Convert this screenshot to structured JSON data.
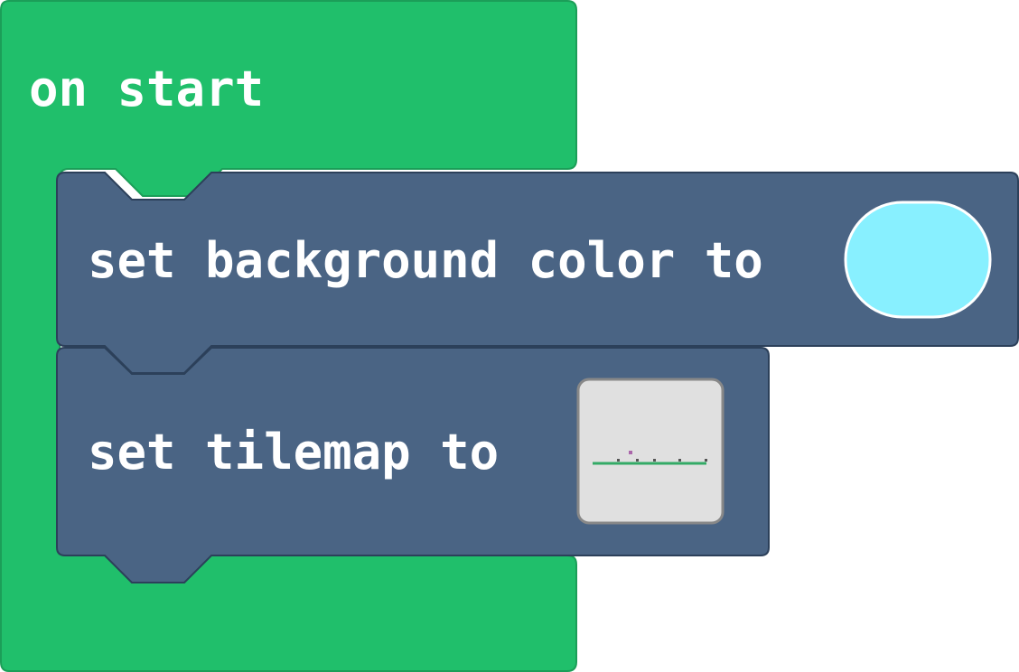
{
  "colors": {
    "event_block": "#20bf6b",
    "event_block_border": "#1b9e58",
    "scene_block": "#4a6484",
    "scene_block_border": "#2c405a",
    "color_swatch": "#88f0ff",
    "tilemap_thumb_bg": "#e0e0e0",
    "tilemap_thumb_border": "#888888",
    "tilemap_ground": "#33aa66"
  },
  "on_start_block": {
    "label": "on start"
  },
  "set_background_block": {
    "label": "set background color to",
    "value_icon": "color-swatch-icon"
  },
  "set_tilemap_block": {
    "label": "set tilemap to",
    "value_icon": "tilemap-thumbnail-icon"
  }
}
